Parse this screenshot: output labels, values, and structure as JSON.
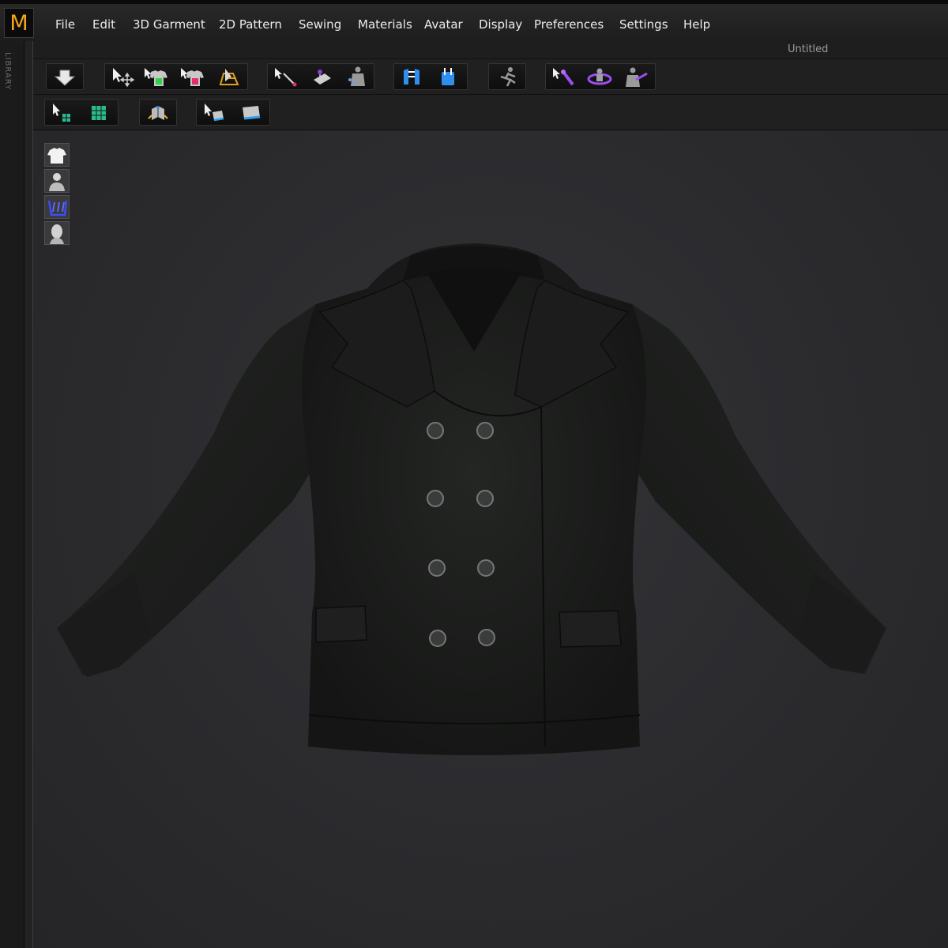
{
  "app": {
    "logo_letter": "M",
    "document_title": "Untitled",
    "accent": "#f2a619"
  },
  "menu": [
    "File",
    "Edit",
    "3D Garment",
    "2D Pattern",
    "Sewing",
    "Materials",
    "Avatar",
    "Display",
    "Preferences",
    "Settings",
    "Help"
  ],
  "library": {
    "label": "LIBRARY"
  },
  "toolbar": {
    "row1_icons": [
      "simulate-icon",
      "transform-pattern-icon",
      "select-mesh-icon",
      "select-mesh-pink-icon",
      "fold-arrangement-icon",
      "edit-curvature-icon",
      "tack-icon",
      "avatar-arrangement-icon",
      "arrangement-points-icon",
      "reset-arrangement-icon",
      "record-animation-icon",
      "pin-tool-icon",
      "ring-pin-icon",
      "measure-avatar-icon"
    ],
    "row2_icons": [
      "select-uv-icon",
      "texture-checker-icon",
      "fold-3d-icon",
      "select-texture-icon",
      "flat-texture-icon"
    ]
  },
  "viewport": {
    "side_icons": [
      "show-garment-icon",
      "show-avatar-icon",
      "show-pattern-icon",
      "avatar-head-icon"
    ],
    "garment": {
      "name_icon": "peacoat-3d-model",
      "fabric_color": "#1c1d1c",
      "button_count": 8
    }
  }
}
